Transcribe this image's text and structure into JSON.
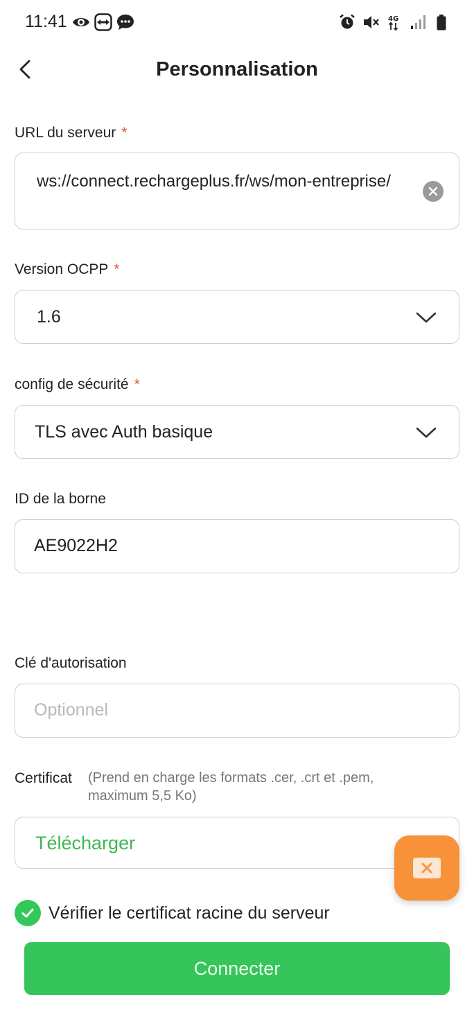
{
  "status_bar": {
    "time": "11:41",
    "left_icons": [
      "eye-icon",
      "teamviewer-icon",
      "chat-bubble-icon"
    ],
    "right_icons": [
      "alarm-icon",
      "mute-icon",
      "4g-data-icon",
      "signal-icon",
      "battery-icon"
    ],
    "network_label": "4G"
  },
  "header": {
    "back_icon": "chevron-left-icon",
    "title": "Personnalisation"
  },
  "server_url": {
    "label": "URL du serveur",
    "required_mark": "*",
    "value": "ws://connect.rechargeplus.fr/ws/mon-entreprise/",
    "clear_icon": "clear-circle-icon"
  },
  "ocpp_version": {
    "label": "Version OCPP",
    "required_mark": "*",
    "selected": "1.6"
  },
  "security_config": {
    "label": "config de sécurité",
    "required_mark": "*",
    "selected": "TLS avec Auth basique"
  },
  "station_id": {
    "label": "ID de la borne",
    "value": "AE9022H2"
  },
  "auth_key": {
    "label": "Clé d'autorisation",
    "value": "",
    "placeholder": "Optionnel"
  },
  "certificate": {
    "label": "Certificat",
    "hint": "(Prend en charge les formats .cer, .crt et .pem, maximum 5,5 Ko)",
    "upload_label": "Télécharger"
  },
  "fab": {
    "icon": "close-box-icon"
  },
  "verify_root": {
    "checked": true,
    "label": "Vérifier le certificat racine du serveur"
  },
  "connect_button": {
    "label": "Connecter"
  },
  "colors": {
    "accent_green": "#35c55a",
    "check_green": "#34c759",
    "link_green": "#3db850",
    "fab_orange": "#f7913a",
    "required_red": "#e0533a"
  }
}
